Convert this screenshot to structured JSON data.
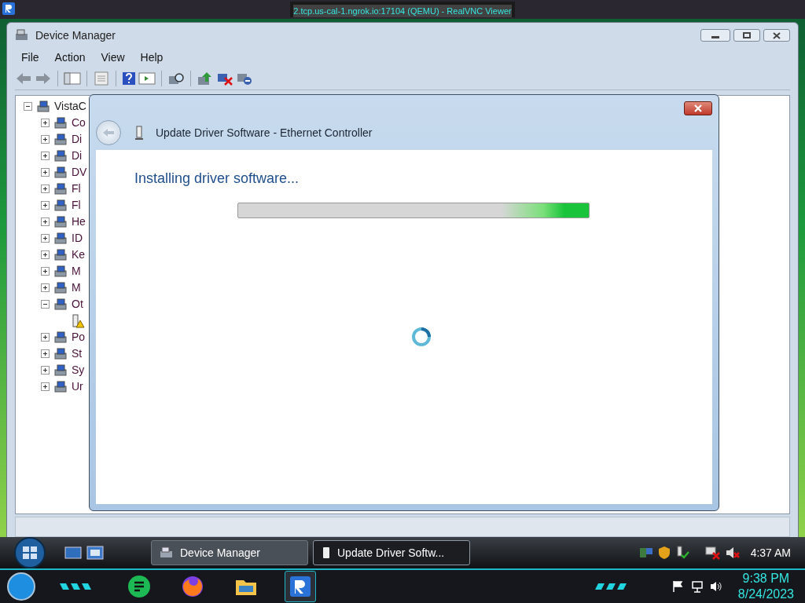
{
  "viewer": {
    "title": "2.tcp.us-cal-1.ngrok.io:17104 (QEMU) - RealVNC Viewer"
  },
  "window": {
    "title": "Device Manager"
  },
  "menu": [
    "File",
    "Action",
    "View",
    "Help"
  ],
  "tree": {
    "label": "VistaC",
    "expanded": true,
    "children": [
      {
        "label": "Co",
        "expanded": false
      },
      {
        "label": "Di",
        "expanded": false
      },
      {
        "label": "Di",
        "expanded": false
      },
      {
        "label": "DV",
        "expanded": false
      },
      {
        "label": "Fl",
        "expanded": false
      },
      {
        "label": "Fl",
        "expanded": false
      },
      {
        "label": "He",
        "expanded": false
      },
      {
        "label": "ID",
        "expanded": false
      },
      {
        "label": "Ke",
        "expanded": false
      },
      {
        "label": "M",
        "expanded": false
      },
      {
        "label": "M",
        "expanded": false
      },
      {
        "label": "Ot",
        "expanded": true,
        "children": [
          {
            "kind": "warning"
          }
        ]
      },
      {
        "label": "Po",
        "expanded": false
      },
      {
        "label": "St",
        "expanded": false
      },
      {
        "label": "Sy",
        "expanded": false
      },
      {
        "label": "Ur",
        "expanded": false
      }
    ]
  },
  "dialog": {
    "title": "Update Driver Software - Ethernet Controller",
    "heading": "Installing driver software...",
    "progress": {
      "kind": "marquee"
    }
  },
  "taskbar": {
    "tasks": [
      {
        "label": "Device Manager",
        "selected": false
      },
      {
        "label": "Update Driver Softw...",
        "selected": true
      }
    ],
    "clock": "4:37 AM"
  },
  "host_taskbar": {
    "apps": [
      {
        "kind": "notes",
        "selected": false
      },
      {
        "kind": "browser",
        "selected": false
      },
      {
        "kind": "files",
        "selected": false
      },
      {
        "kind": "vnc",
        "selected": true
      }
    ],
    "time": "9:38 PM",
    "date": "8/24/2023"
  }
}
